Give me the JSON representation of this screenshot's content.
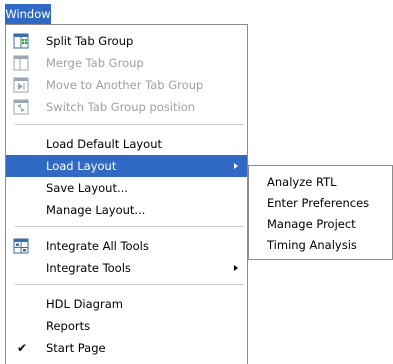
{
  "menubar": {
    "active_menu": "Window"
  },
  "menu": {
    "items": [
      {
        "label": "Split Tab Group",
        "icon": "split-tab-group-icon",
        "enabled": true
      },
      {
        "label": "Merge Tab Group",
        "icon": "merge-tab-group-icon",
        "enabled": false
      },
      {
        "label": "Move to Another Tab Group",
        "icon": "move-tab-group-icon",
        "enabled": false
      },
      {
        "label": "Switch Tab Group position",
        "icon": "switch-tab-group-icon",
        "enabled": false
      },
      {
        "label": "Load Default Layout",
        "enabled": true
      },
      {
        "label": "Load Layout",
        "enabled": true,
        "highlighted": true,
        "has_submenu": true
      },
      {
        "label": "Save Layout...",
        "enabled": true
      },
      {
        "label": "Manage Layout...",
        "enabled": true
      },
      {
        "label": "Integrate All Tools",
        "icon": "integrate-tools-icon",
        "enabled": true
      },
      {
        "label": "Integrate Tools",
        "enabled": true,
        "has_submenu": true
      },
      {
        "label": "HDL Diagram",
        "enabled": true
      },
      {
        "label": "Reports",
        "enabled": true
      },
      {
        "label": "Start Page",
        "enabled": true,
        "checked": true
      }
    ]
  },
  "submenu": {
    "items": [
      {
        "label": "Analyze RTL"
      },
      {
        "label": "Enter Preferences"
      },
      {
        "label": "Manage Project"
      },
      {
        "label": "Timing Analysis"
      }
    ]
  },
  "colors": {
    "highlight": "#316ac5",
    "disabled_text": "#a0a0a0"
  }
}
